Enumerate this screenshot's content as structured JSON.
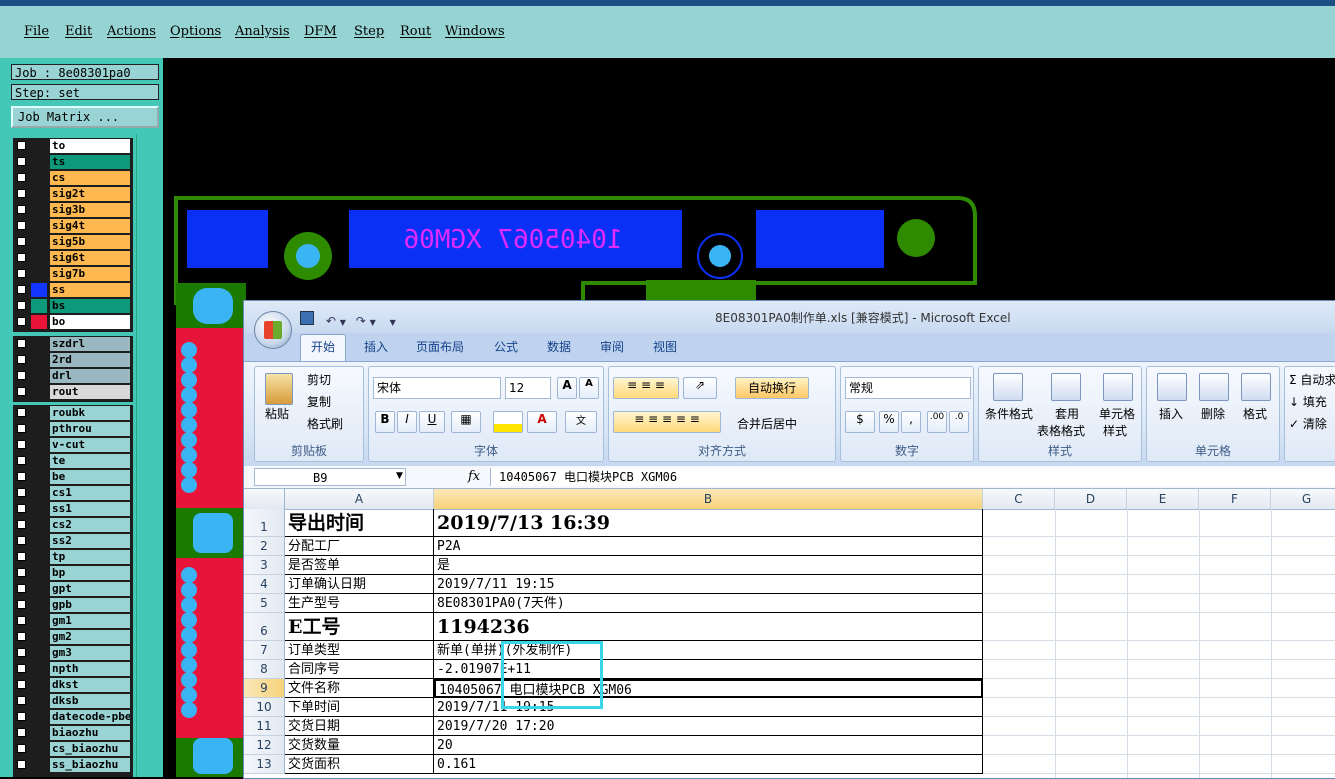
{
  "menubar": {
    "items": [
      "File",
      "Edit",
      "Actions",
      "Options",
      "Analysis",
      "DFM",
      "Step",
      "Rout",
      "Windows"
    ]
  },
  "left_panel": {
    "job": "Job : 8e08301pa0",
    "step": "Step: set",
    "job_matrix": "Job Matrix ...",
    "group1": [
      {
        "name": "to",
        "color": "#ffffff"
      },
      {
        "name": "ts",
        "color": "#0c9a7a"
      },
      {
        "name": "cs",
        "color": "#fdb94f"
      },
      {
        "name": "sig2t",
        "color": "#fdb94f"
      },
      {
        "name": "sig3b",
        "color": "#fdb94f"
      },
      {
        "name": "sig4t",
        "color": "#fdb94f"
      },
      {
        "name": "sig5b",
        "color": "#fdb94f"
      },
      {
        "name": "sig6t",
        "color": "#fdb94f"
      },
      {
        "name": "sig7b",
        "color": "#fdb94f"
      },
      {
        "name": "ss",
        "color": "#fdb94f"
      },
      {
        "name": "bs",
        "color": "#0c9a7a"
      },
      {
        "name": "bo",
        "color": "#ffffff"
      }
    ],
    "group2": [
      {
        "name": "szdrl",
        "color": "#9ab8c0"
      },
      {
        "name": "2rd",
        "color": "#9ab8c0"
      },
      {
        "name": "drl",
        "color": "#9ab8c0"
      },
      {
        "name": "rout",
        "color": "#d9d9d9"
      }
    ],
    "group3": [
      "roubk",
      "pthrou",
      "v-cut",
      "te",
      "be",
      "cs1",
      "ss1",
      "cs2",
      "ss2",
      "tp",
      "bp",
      "gpt",
      "gpb",
      "gm1",
      "gm2",
      "gm3",
      "npth",
      "dkst",
      "dksb",
      "datecode-pbe",
      "biaozhu",
      "cs_biaozhu",
      "ss_biaozhu"
    ]
  },
  "pcb": {
    "label": "10405067 XGM06"
  },
  "excel": {
    "title": "8E08301PA0制作单.xls  [兼容模式] - Microsoft Excel",
    "tabs": [
      "开始",
      "插入",
      "页面布局",
      "公式",
      "数据",
      "审阅",
      "视图"
    ],
    "ribbon": {
      "paste": "粘贴",
      "cut": "剪切",
      "copy": "复制",
      "format_painter": "格式刷",
      "clipboard": "剪贴板",
      "font_name": "宋体",
      "font_size": "12",
      "font": "字体",
      "wrap": "自动换行",
      "merge": "合并后居中",
      "alignment": "对齐方式",
      "number_format": "常规",
      "number": "数字",
      "cond_format": "条件格式",
      "table_format_1": "套用",
      "table_format_2": "表格格式",
      "cell_style_1": "单元格",
      "cell_style_2": "样式",
      "styles": "样式",
      "insert": "插入",
      "delete": "删除",
      "format": "格式",
      "cells": "单元格",
      "autosum": "自动求",
      "fill": "填充",
      "clear": "清除"
    },
    "name_box": "B9",
    "formula": "10405067 电口模块PCB XGM06",
    "columns": [
      "A",
      "B",
      "C",
      "D",
      "E",
      "F",
      "G"
    ],
    "rows": [
      {
        "n": "1",
        "a": "导出时间",
        "b": "2019/7/13 16:39",
        "big": true
      },
      {
        "n": "2",
        "a": "分配工厂",
        "b": "P2A"
      },
      {
        "n": "3",
        "a": "是否签单",
        "b": "是"
      },
      {
        "n": "4",
        "a": "订单确认日期",
        "b": "2019/7/11 19:15"
      },
      {
        "n": "5",
        "a": "生产型号",
        "b": "8E08301PA0(7天件)"
      },
      {
        "n": "6",
        "a": "E工号",
        "b": "1194236",
        "big": true
      },
      {
        "n": "7",
        "a": "订单类型",
        "b": "新单(单拼)(外发制作)"
      },
      {
        "n": "8",
        "a": "合同序号",
        "b": "-2.01907E+11"
      },
      {
        "n": "9",
        "a": "文件名称",
        "b": "10405067 电口模块PCB XGM06"
      },
      {
        "n": "10",
        "a": "下单时间",
        "b": "2019/7/11 19:15"
      },
      {
        "n": "11",
        "a": "交货日期",
        "b": "2019/7/20 17:20"
      },
      {
        "n": "12",
        "a": "交货数量",
        "b": "20"
      },
      {
        "n": "13",
        "a": "交货面积",
        "b": "0.161"
      }
    ]
  }
}
